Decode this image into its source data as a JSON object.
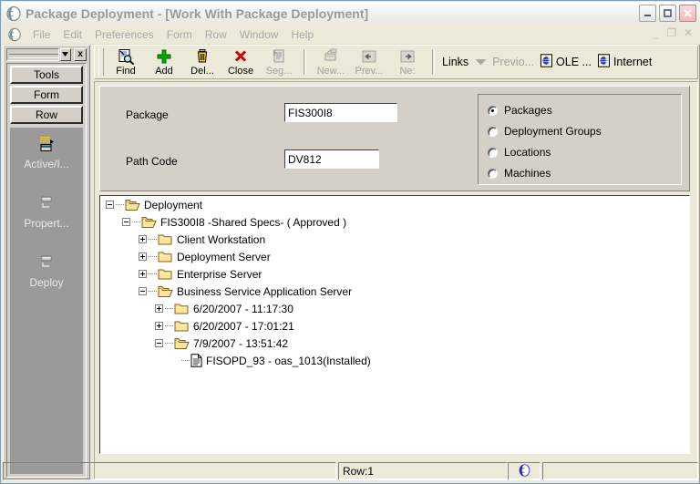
{
  "window": {
    "title": "Package Deployment - [Work With Package Deployment]",
    "icon": "globe-icon",
    "controls": {
      "minimize": "_",
      "maximize": "□",
      "close": "✕"
    },
    "mdi_controls": {
      "minimize": "_",
      "restore": "❐",
      "close": "✕"
    }
  },
  "menubar": {
    "icon": "globe-icon",
    "items": [
      {
        "label": "File"
      },
      {
        "label": "Edit"
      },
      {
        "label": "Preferences"
      },
      {
        "label": "Form"
      },
      {
        "label": "Row"
      },
      {
        "label": "Window"
      },
      {
        "label": "Help"
      }
    ]
  },
  "sidebar": {
    "close_label": "x",
    "buttons": [
      {
        "label": "Tools"
      },
      {
        "label": "Form"
      },
      {
        "label": "Row"
      }
    ],
    "items": [
      {
        "label": "Active/I...",
        "icon": "active-inactive-icon"
      },
      {
        "label": "Propert...",
        "icon": "properties-icon"
      },
      {
        "label": "Deploy",
        "icon": "deploy-icon"
      }
    ]
  },
  "toolbar": {
    "buttons": [
      {
        "label": "Find",
        "icon": "find-icon",
        "disabled": false
      },
      {
        "label": "Add",
        "icon": "add-icon",
        "disabled": false
      },
      {
        "label": "Del...",
        "icon": "delete-icon",
        "disabled": false
      },
      {
        "label": "Close",
        "icon": "close-x-icon",
        "disabled": false
      },
      {
        "label": "Seg...",
        "icon": "select-icon",
        "disabled": true
      },
      {
        "label": "New...",
        "icon": "new-icon",
        "disabled": true
      },
      {
        "label": "Prev...",
        "icon": "arrow-left-icon",
        "disabled": true
      },
      {
        "label": "Ne:",
        "icon": "arrow-right-icon",
        "disabled": true
      }
    ],
    "links_label": "Links",
    "links": [
      {
        "label": "Previo...",
        "icon": "chevron-down-icon",
        "disabled": true
      },
      {
        "label": "OLE ...",
        "icon": "ole-document-icon",
        "disabled": false
      },
      {
        "label": "Internet",
        "icon": "internet-document-icon",
        "disabled": false
      }
    ]
  },
  "form": {
    "fields": [
      {
        "label": "Package",
        "value": "FIS300I8",
        "placeholder": ""
      },
      {
        "label": "Path Code",
        "value": "DV812",
        "placeholder": ""
      }
    ],
    "radio_options": [
      {
        "label": "Packages",
        "selected": true
      },
      {
        "label": "Deployment Groups",
        "selected": false
      },
      {
        "label": "Locations",
        "selected": false
      },
      {
        "label": "Machines",
        "selected": false
      }
    ]
  },
  "tree": {
    "nodes": [
      {
        "label": "Deployment",
        "depth": 0,
        "toggle": "minus",
        "icon": "folder-open-icon"
      },
      {
        "label": "FIS300I8  -Shared Specs-   ( Approved )",
        "depth": 1,
        "toggle": "minus",
        "icon": "folder-open-icon"
      },
      {
        "label": "Client Workstation",
        "depth": 2,
        "toggle": "plus",
        "icon": "folder-closed-icon"
      },
      {
        "label": "Deployment Server",
        "depth": 2,
        "toggle": "plus",
        "icon": "folder-closed-icon"
      },
      {
        "label": "Enterprise Server",
        "depth": 2,
        "toggle": "plus",
        "icon": "folder-closed-icon"
      },
      {
        "label": "Business Service Application Server",
        "depth": 2,
        "toggle": "minus",
        "icon": "folder-open-icon"
      },
      {
        "label": "6/20/2007 - 11:17:30",
        "depth": 3,
        "toggle": "plus",
        "icon": "folder-closed-icon"
      },
      {
        "label": "6/20/2007 - 17:01:21",
        "depth": 3,
        "toggle": "plus",
        "icon": "folder-closed-icon"
      },
      {
        "label": "7/9/2007 - 13:51:42",
        "depth": 3,
        "toggle": "minus",
        "icon": "folder-open-icon"
      },
      {
        "label": "FISOPD_93 - oas_1013(Installed)",
        "depth": 4,
        "toggle": "none",
        "icon": "document-icon"
      }
    ]
  },
  "statusbar": {
    "row_label": "Row:1",
    "icon": "globe-icon"
  },
  "colors": {
    "face": "#d4d0c8",
    "window_face": "#ece9d8",
    "sidebar_items_bg": "#9a9a9a",
    "folder": "#ffe49b",
    "folder_edge": "#a08a3c",
    "accent_green": "#00a000",
    "accent_red": "#d80000",
    "title_text": "#9a9a9a"
  }
}
